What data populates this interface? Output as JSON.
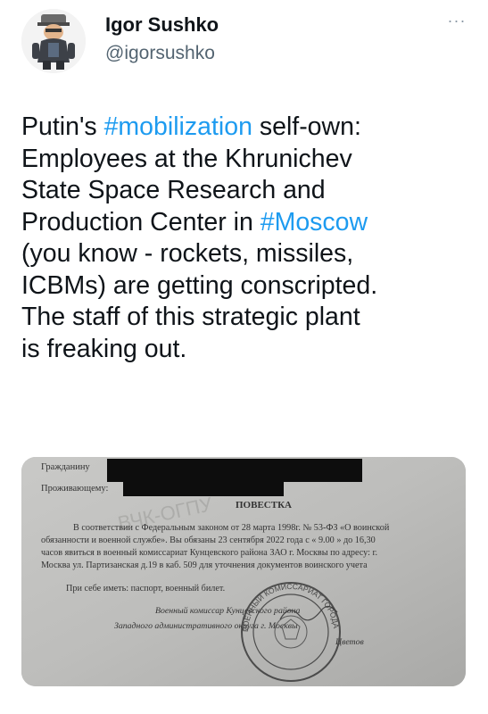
{
  "tweet": {
    "author": {
      "display_name": "Igor Sushko",
      "handle": "@igorsushko",
      "avatar_icon": "cartoon-avatar-icon"
    },
    "more_label": "···",
    "text_lines": [
      {
        "before": "Putin's ",
        "hashtag": "#mobilization",
        "after": " self-own:"
      },
      {
        "before": "Employees at the Khrunichev",
        "hashtag": "",
        "after": ""
      },
      {
        "before": "State Space Research and",
        "hashtag": "",
        "after": ""
      },
      {
        "before": "Production Center in ",
        "hashtag": "#Moscow",
        "after": ""
      },
      {
        "before": "(you know - rockets, missiles,",
        "hashtag": "",
        "after": ""
      },
      {
        "before": "ICBMs) are getting conscripted.",
        "hashtag": "",
        "after": ""
      },
      {
        "before": "The staff of this strategic plant",
        "hashtag": "",
        "after": ""
      },
      {
        "before": "is freaking out.",
        "hashtag": "",
        "after": ""
      }
    ],
    "hashtag_color": "#1d9bf0"
  },
  "document": {
    "field_citizen": "Гражданину",
    "field_residing": "Проживающему:",
    "title": "ПОВЕСТКА",
    "body_lines": [
      "В соответствии с Федеральным законом от 28 марта 1998г. № 53-ФЗ «О воинской",
      "обязанности и военной службе». Вы обязаны 23 сентября 2022 года с « 9.00 » до 16,30",
      "часов явиться в военный комиссариат Кунцевского района ЗАО г. Москвы по адресу: г.",
      "Москва ул. Партизанская д.19 в каб. 509 для уточнения документов воинского учета"
    ],
    "bring_line": "При себе иметь: паспорт, военный билет.",
    "signature_lines": [
      "Военный комиссар Кунцевского района",
      "Западного административного округа г. Москвы"
    ],
    "signer": "Цветов",
    "stamp_text": "ВОЕННЫЙ КОМИССАРИАТ ГОРОДА МОСКВЫ",
    "watermark": "ВЧК-ОГПУ"
  }
}
